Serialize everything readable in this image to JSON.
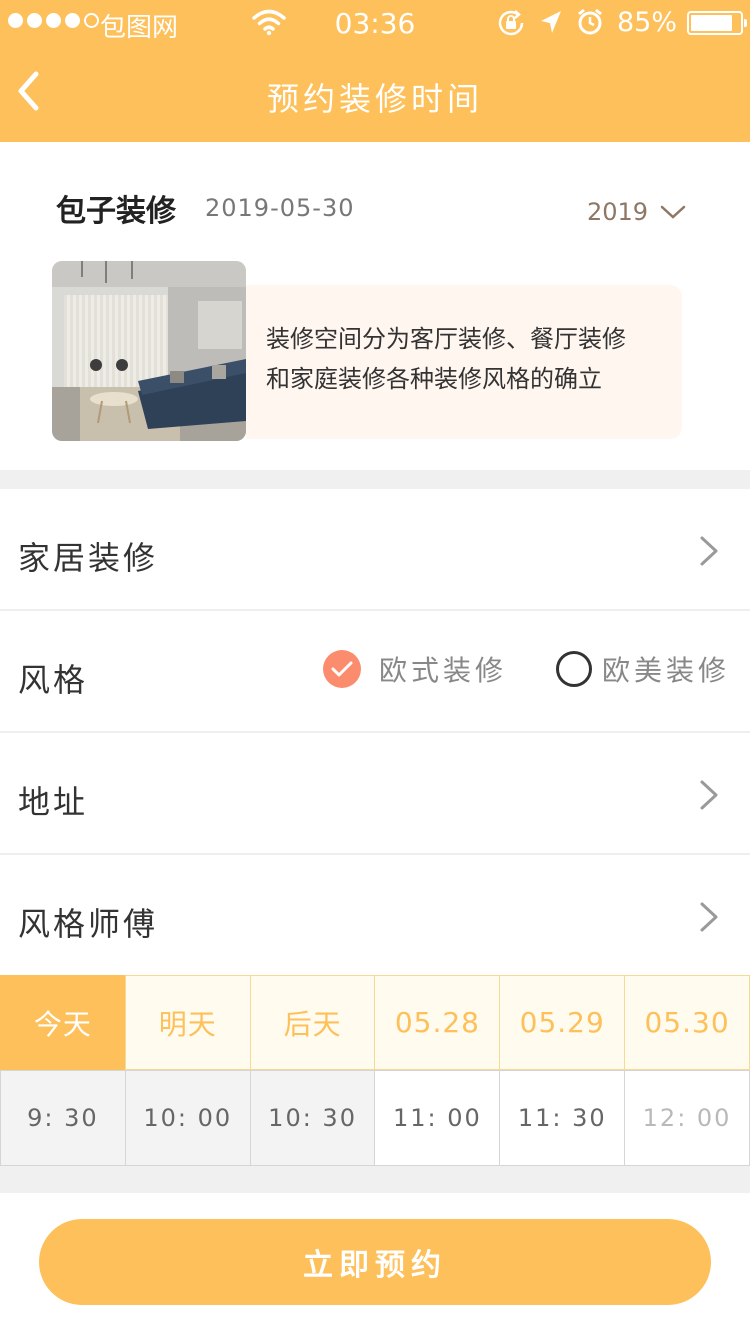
{
  "status_bar": {
    "carrier": "包图网",
    "time": "03:36",
    "battery_percent": "85%",
    "battery_level": 0.85,
    "icons": [
      "signal-dots-icon",
      "wifi-icon",
      "rotation-lock-icon",
      "location-arrow-icon",
      "alarm-icon",
      "battery-icon"
    ]
  },
  "navbar": {
    "title": "预约装修时间",
    "back_icon": "chevron-left-icon"
  },
  "shop": {
    "name": "包子装修",
    "date": "2019-05-30",
    "year_select": "2019",
    "description_line1": "装修空间分为客厅装修、餐厅装修",
    "description_line2": "和家庭装修各种装修风格的确立"
  },
  "rows": {
    "home": {
      "label": "家居装修"
    },
    "style": {
      "label": "风格",
      "option1": "欧式装修",
      "option1_selected": true,
      "option2": "欧美装修",
      "option2_selected": false
    },
    "address": {
      "label": "地址"
    },
    "master": {
      "label": "风格师傅"
    }
  },
  "days": [
    "今天",
    "明天",
    "后天",
    "05.28",
    "05.29",
    "05.30"
  ],
  "selected_day": "今天",
  "slots": [
    "9: 30",
    "10: 00",
    "10: 30",
    "11: 00",
    "11: 30",
    "12: 00"
  ],
  "submit_label": "立即预约",
  "colors": {
    "accent": "#FDC05A",
    "radio_checked": "#FB8D6E",
    "desc_background": "#FFF6F0"
  }
}
